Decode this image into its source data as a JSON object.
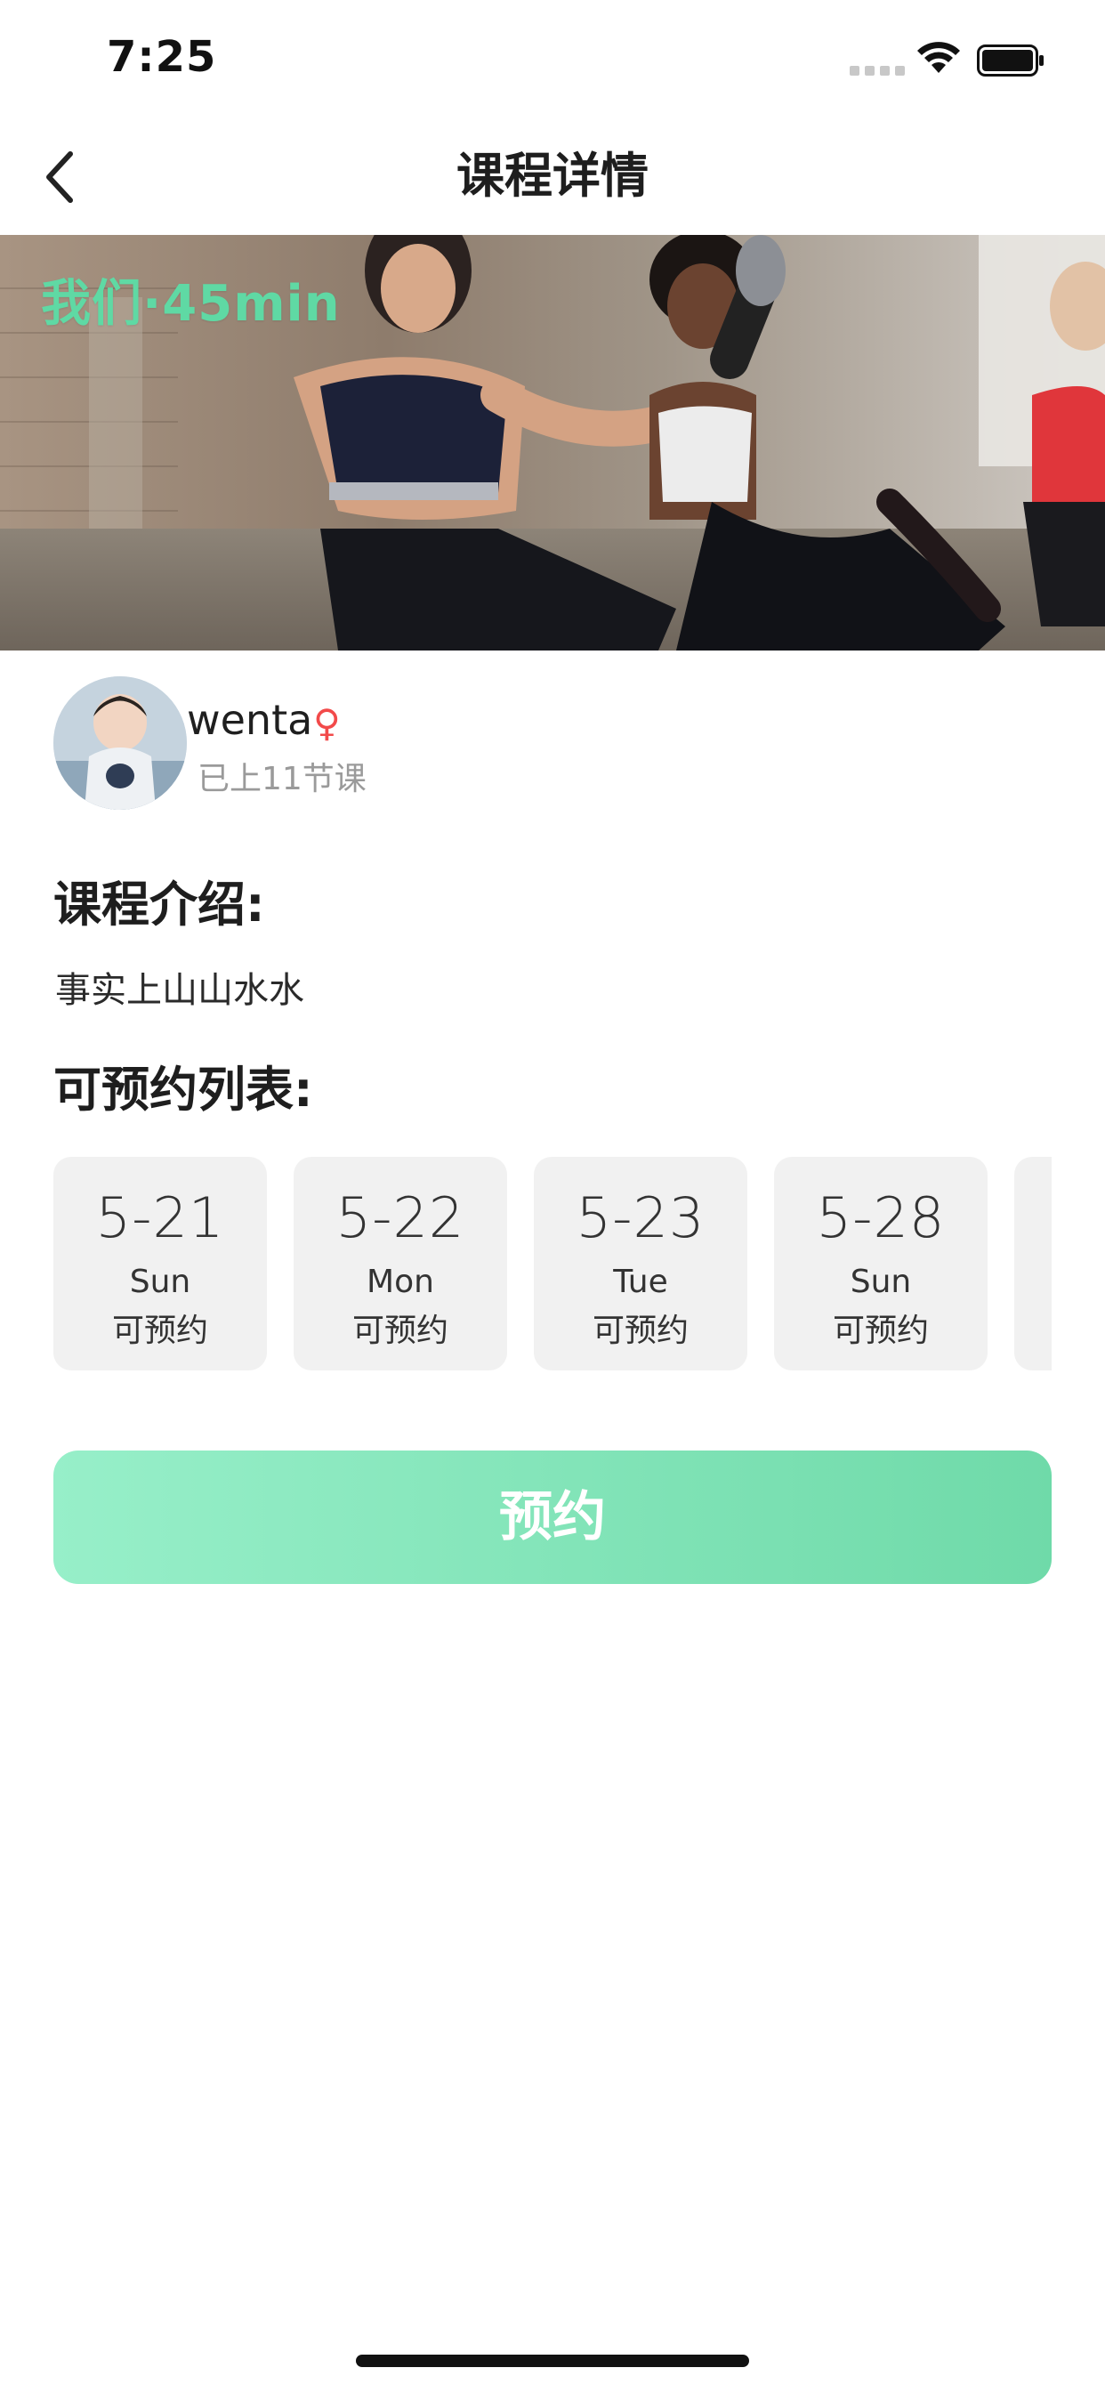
{
  "status_bar": {
    "time": "7:25",
    "icons": [
      "signal-icon",
      "wifi-icon",
      "battery-icon"
    ]
  },
  "nav": {
    "title": "课程详情",
    "back_icon": "chevron-left-icon"
  },
  "hero": {
    "caption": "我们·45min",
    "caption_color": "#5fd9a4"
  },
  "coach": {
    "name": "wenta",
    "gender_symbol": "♀",
    "gender_color": "#f24a4a",
    "stats": "已上11节课"
  },
  "intro": {
    "title": "课程介绍:",
    "text": "事实上山山水水"
  },
  "schedule": {
    "title": "可预约列表:",
    "dates": [
      {
        "date": "5-21",
        "weekday": "Sun",
        "status": "可预约"
      },
      {
        "date": "5-22",
        "weekday": "Mon",
        "status": "可预约"
      },
      {
        "date": "5-23",
        "weekday": "Tue",
        "status": "可预约"
      },
      {
        "date": "5-28",
        "weekday": "Sun",
        "status": "可预约"
      }
    ]
  },
  "book_button": {
    "label": "预约",
    "gradient_start": "#97efc9",
    "gradient_end": "#6fdaa9"
  }
}
